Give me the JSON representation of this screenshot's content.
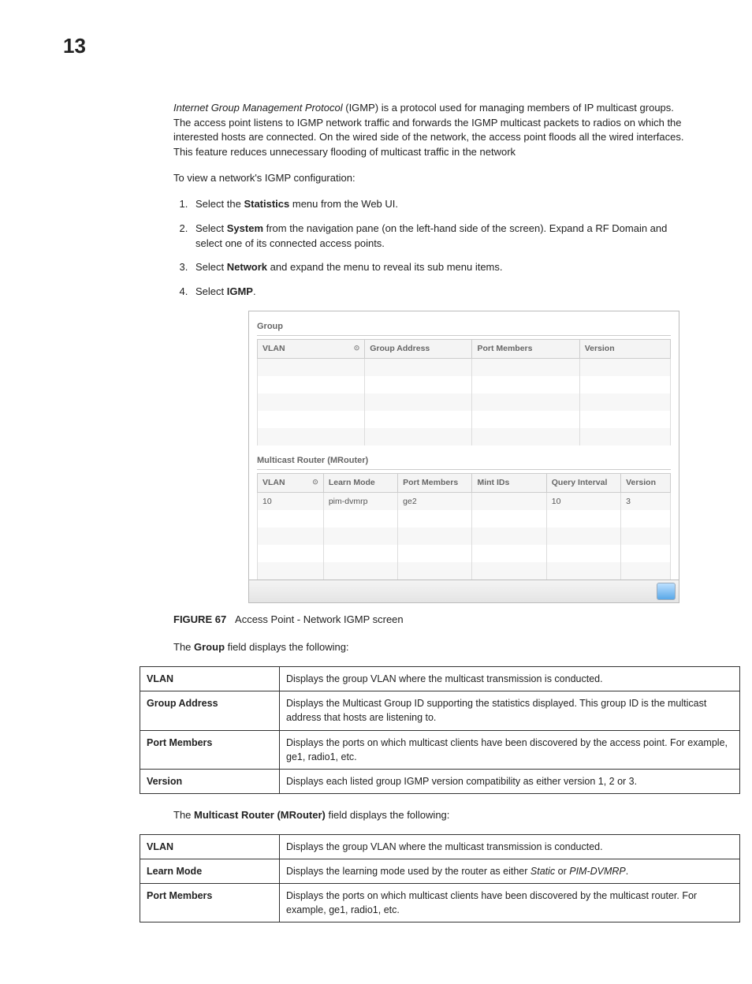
{
  "page_number": "13",
  "intro_para_prefix_italic": "Internet Group Management Protocol",
  "intro_para_rest": " (IGMP) is a protocol used for managing members of IP multicast groups. The access point listens to IGMP network traffic and forwards the IGMP multicast packets to radios on which the interested hosts are connected. On the wired side of the network, the access point floods all the wired interfaces. This feature reduces unnecessary flooding of multicast traffic in the network",
  "to_view_line": "To view a network's IGMP configuration:",
  "steps": [
    {
      "pre": "Select the ",
      "bold": "Statistics",
      "post": " menu from the Web UI."
    },
    {
      "pre": "Select ",
      "bold": "System",
      "post": " from the navigation pane (on the left-hand side of the screen). Expand a RF Domain and select one of its connected access points."
    },
    {
      "pre": "Select ",
      "bold": "Network",
      "post": " and expand the menu to reveal its sub menu items."
    },
    {
      "pre": "Select ",
      "bold": "IGMP",
      "post": "."
    }
  ],
  "ui": {
    "group_title": "Group",
    "group_cols": [
      "VLAN",
      "Group Address",
      "Port Members",
      "Version"
    ],
    "mrouter_title": "Multicast Router (MRouter)",
    "mrouter_cols": [
      "VLAN",
      "Learn Mode",
      "Port Members",
      "Mint IDs",
      "Query Interval",
      "Version"
    ],
    "mrouter_row": [
      "10",
      "pim-dvmrp",
      "ge2",
      "",
      "10",
      "3"
    ]
  },
  "figure_label": "FIGURE 67",
  "figure_caption": "Access Point - Network IGMP screen",
  "group_intro_pre": "The ",
  "group_intro_bold": "Group",
  "group_intro_post": " field displays the following:",
  "group_table": [
    {
      "k": "VLAN",
      "v": "Displays the group VLAN where the multicast transmission is conducted."
    },
    {
      "k": "Group Address",
      "v": "Displays the Multicast Group ID supporting the statistics displayed. This group ID is the multicast address that hosts are listening to."
    },
    {
      "k": "Port Members",
      "v": "Displays the ports on which multicast clients have been discovered by the access point. For example, ge1, radio1, etc."
    },
    {
      "k": "Version",
      "v": "Displays each listed group IGMP version compatibility as either version 1, 2 or 3."
    }
  ],
  "mrouter_intro_pre": "The ",
  "mrouter_intro_bold": "Multicast Router (MRouter)",
  "mrouter_intro_post": " field displays the following:",
  "mrouter_table": [
    {
      "k": "VLAN",
      "v": "Displays the group VLAN where the multicast transmission is conducted."
    },
    {
      "k": "Learn Mode",
      "v_pre": "Displays the learning mode used by the router as either ",
      "v_i1": "Static",
      "v_mid": " or ",
      "v_i2": "PIM-DVMRP",
      "v_post": "."
    },
    {
      "k": "Port Members",
      "v": "Displays the ports on which multicast clients have been discovered by the multicast router. For example, ge1, radio1, etc."
    }
  ]
}
